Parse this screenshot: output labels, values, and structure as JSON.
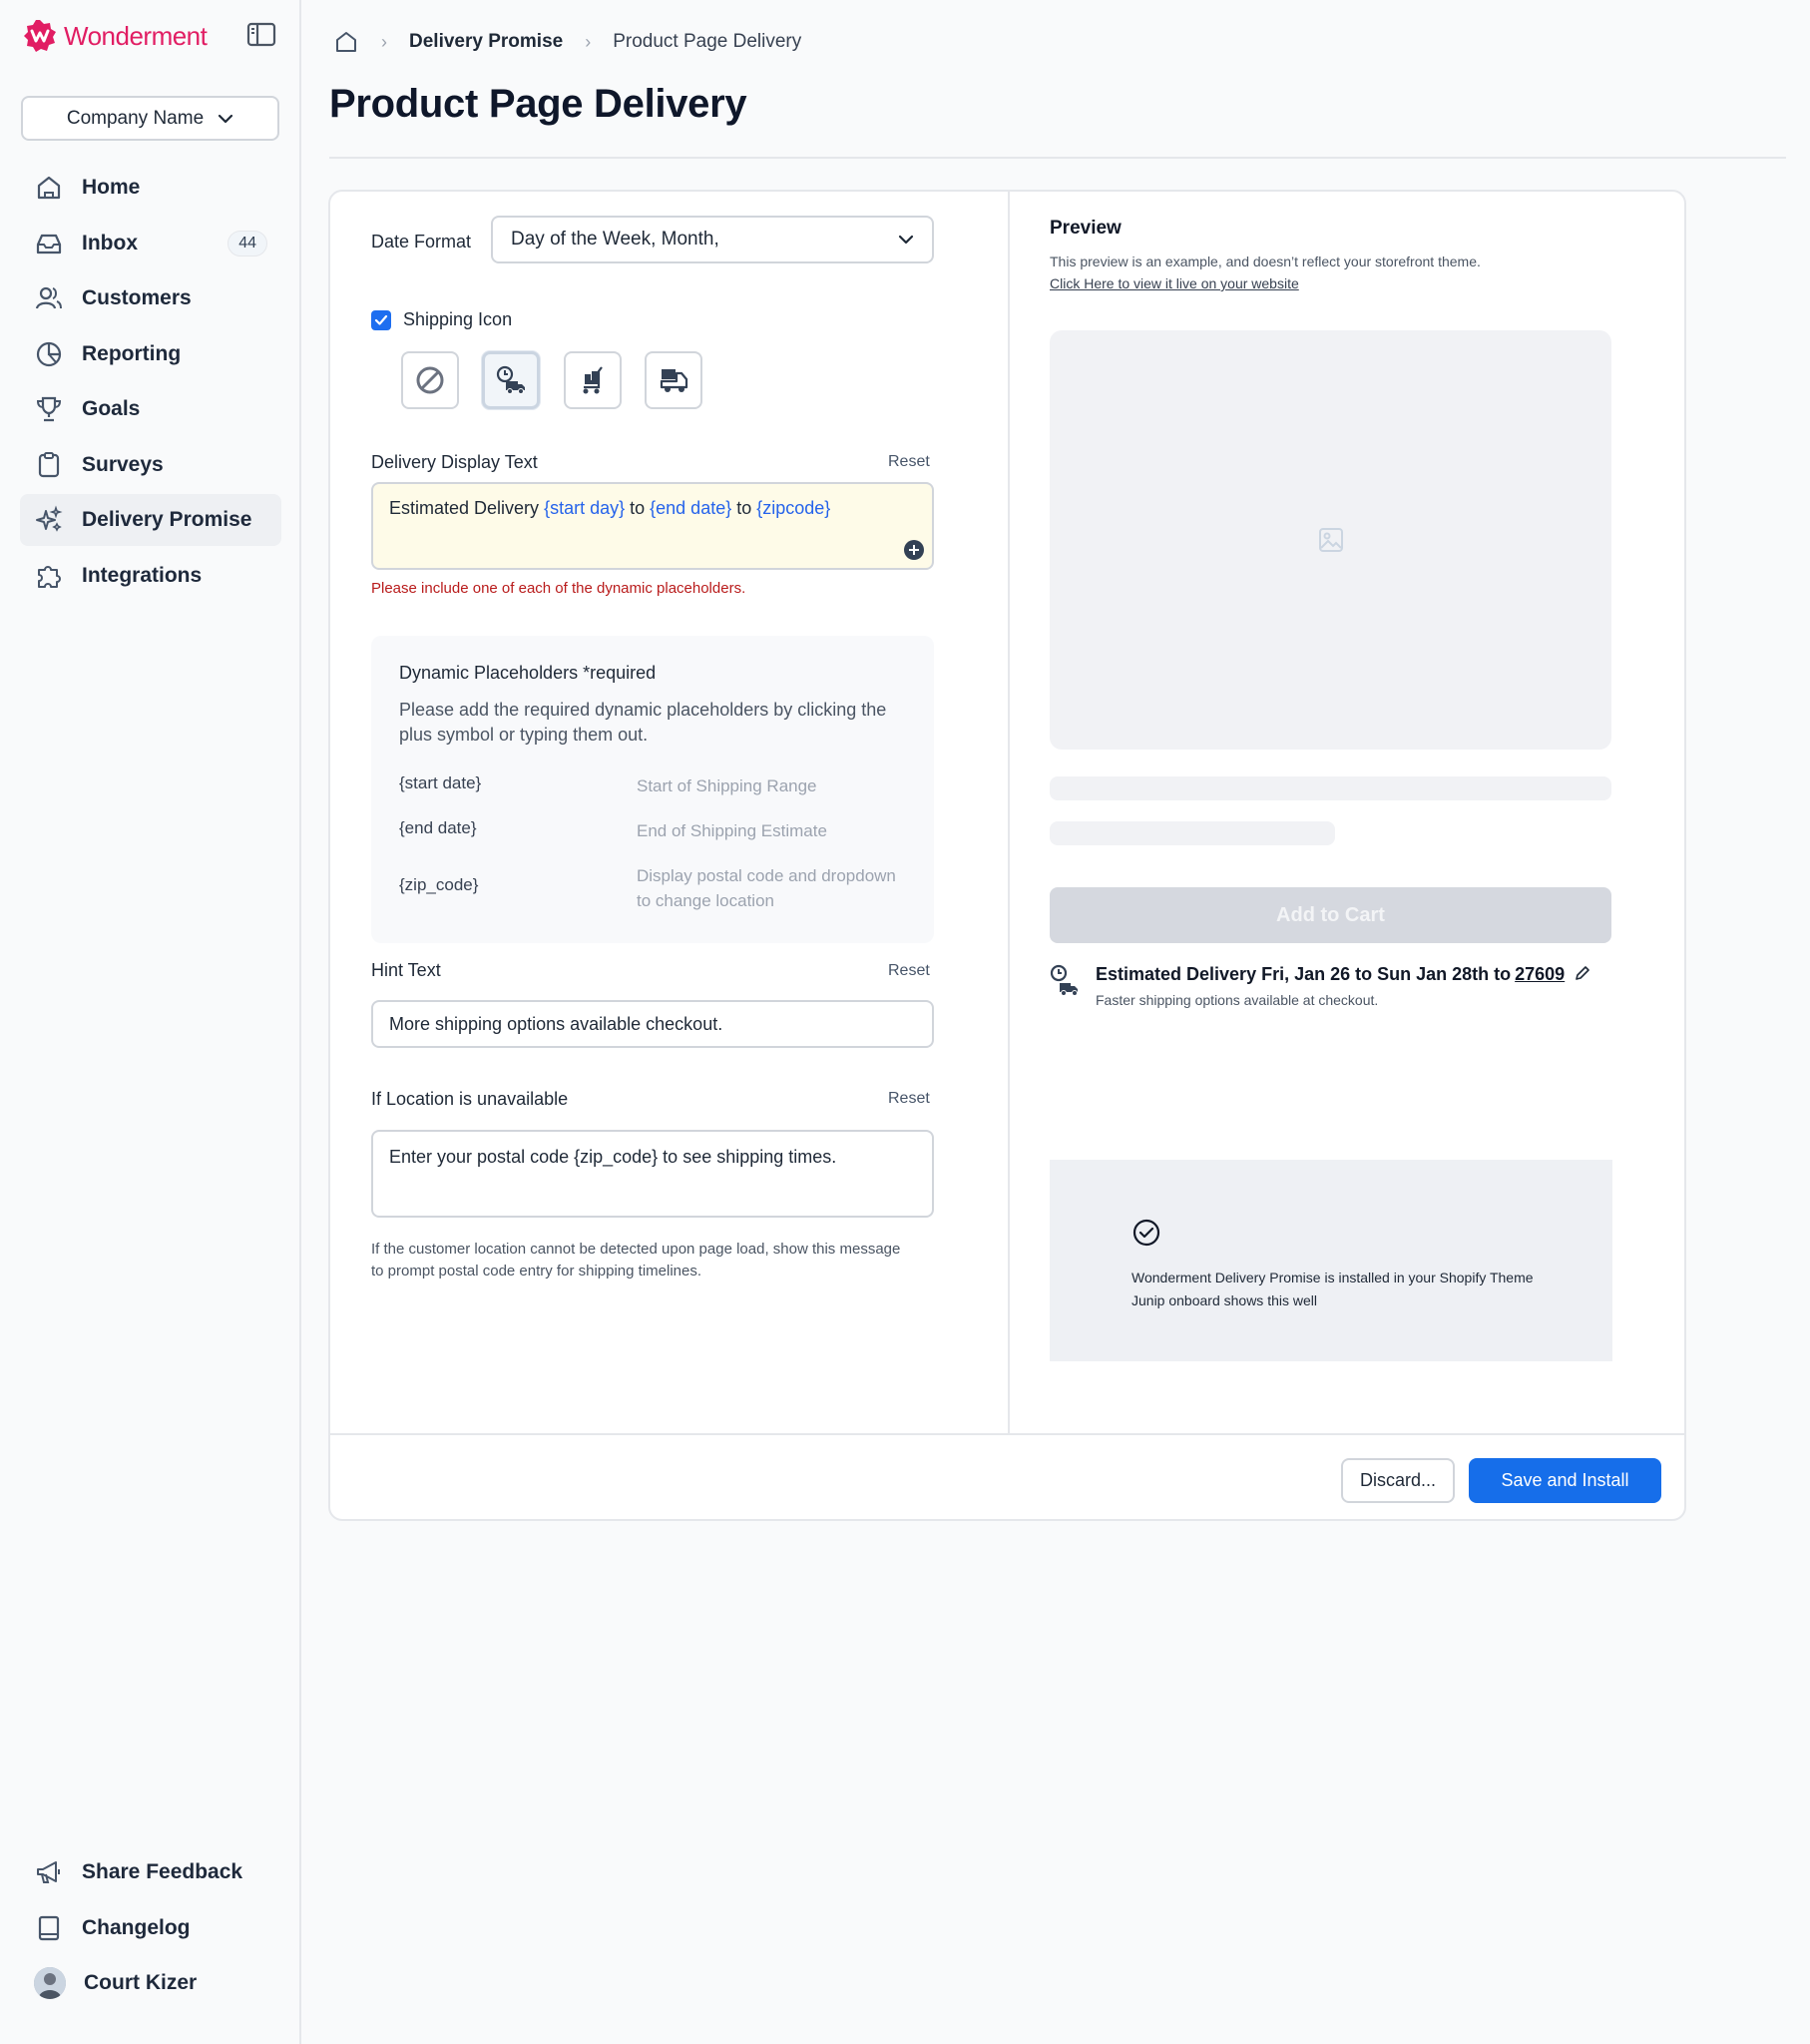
{
  "brand": {
    "name": "Wonderment",
    "color": "#e11d63"
  },
  "company_select": {
    "label": "Company Name"
  },
  "nav": {
    "items": [
      {
        "label": "Home",
        "icon": "home-icon"
      },
      {
        "label": "Inbox",
        "icon": "inbox-icon",
        "badge": "44"
      },
      {
        "label": "Customers",
        "icon": "users-icon"
      },
      {
        "label": "Reporting",
        "icon": "pie-chart-icon"
      },
      {
        "label": "Goals",
        "icon": "trophy-icon"
      },
      {
        "label": "Surveys",
        "icon": "clipboard-icon"
      },
      {
        "label": "Delivery Promise",
        "icon": "sparkles-icon",
        "active": true
      },
      {
        "label": "Integrations",
        "icon": "puzzle-icon"
      }
    ],
    "bottom": [
      {
        "label": "Share Feedback",
        "icon": "megaphone-icon"
      },
      {
        "label": "Changelog",
        "icon": "book-icon"
      },
      {
        "label": "Court Kizer",
        "icon": "avatar"
      }
    ]
  },
  "breadcrumb": {
    "parent": "Delivery Promise",
    "current": "Product Page Delivery"
  },
  "page_title": "Product Page Delivery",
  "form": {
    "date_format": {
      "label": "Date Format",
      "value": "Day of the Week, Month,"
    },
    "shipping_icon": {
      "label": "Shipping Icon",
      "checked": true,
      "options": [
        "none-icon",
        "clock-truck-icon",
        "cart-icon",
        "truck-box-icon"
      ],
      "selected_index": 1
    },
    "display_text": {
      "label": "Delivery Display Text",
      "reset": "Reset",
      "part1": "Estimated Delivery ",
      "ph1": "{start day}",
      "part2": " to ",
      "ph2": "{end date}",
      "part3": " to ",
      "ph3": "{zipcode}",
      "error": "Please include one of each of the dynamic placeholders."
    },
    "placeholders": {
      "title": "Dynamic Placeholders *required",
      "description": "Please add the required dynamic placeholders by clicking the plus symbol or typing them out.",
      "rows": [
        {
          "key": "{start date}",
          "desc": "Start of Shipping Range"
        },
        {
          "key": "{end date}",
          "desc": "End of Shipping Estimate"
        },
        {
          "key": "{zip_code}",
          "desc": "Display postal code and dropdown to change location"
        }
      ]
    },
    "hint": {
      "label": "Hint Text",
      "reset": "Reset",
      "value": "More shipping options available checkout."
    },
    "location": {
      "label": "If Location is unavailable",
      "reset": "Reset",
      "value": "Enter your postal code {zip_code} to see shipping times.",
      "help": "If the customer location cannot be detected upon page load, show this message to prompt postal code entry for shipping timelines."
    }
  },
  "preview": {
    "title": "Preview",
    "note": "This preview is an example, and doesn’t reflect your storefront theme.",
    "link": "Click Here to view it live on your website",
    "add_to_cart": "Add to Cart",
    "estimate_text": "Estimated Delivery Fri, Jan 26 to Sun Jan 28th to",
    "zip": "27609",
    "estimate_sub": "Faster shipping options available at checkout.",
    "well_line1": "Wonderment Delivery Promise is installed in your Shopify Theme",
    "well_line2": "Junip onboard shows this well"
  },
  "actions": {
    "discard": "Discard...",
    "save": "Save and Install",
    "save_color": "#166eea"
  }
}
